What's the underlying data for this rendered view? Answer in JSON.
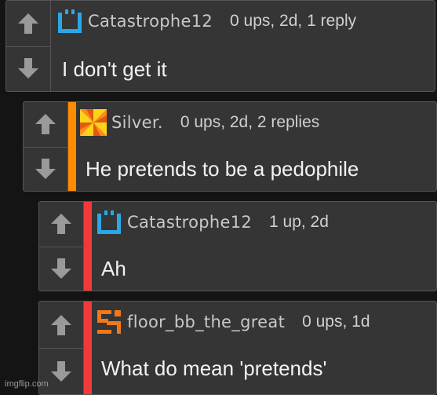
{
  "comments": [
    {
      "username": "Catastrophe12",
      "meta": "0 ups, 2d, 1 reply",
      "text": "I don't get it",
      "avatar_icon": "blue-bracket-icon",
      "accent_color": ""
    },
    {
      "username": "Silver.",
      "meta": "0 ups, 2d, 2 replies",
      "text": "He pretends to be a pedophile",
      "avatar_icon": "yellow-orange-pinwheel-icon",
      "accent_color": "#ff8c00"
    },
    {
      "username": "Catastrophe12",
      "meta": "1 up, 2d",
      "text": "Ah",
      "avatar_icon": "blue-bracket-icon",
      "accent_color": "#f03a3a"
    },
    {
      "username": "floor_bb_the_great",
      "meta": "0 ups, 1d",
      "text": "What do mean 'pretends'",
      "avatar_icon": "orange-block-icon",
      "accent_color": "#f03a3a"
    }
  ],
  "watermark": "imgflip.com",
  "colors": {
    "background": "#141414",
    "card": "#353535",
    "border": "#555555",
    "arrow": "#9a9a9a",
    "text": "#f2f2f2",
    "meta_text": "#d0d0d0"
  }
}
